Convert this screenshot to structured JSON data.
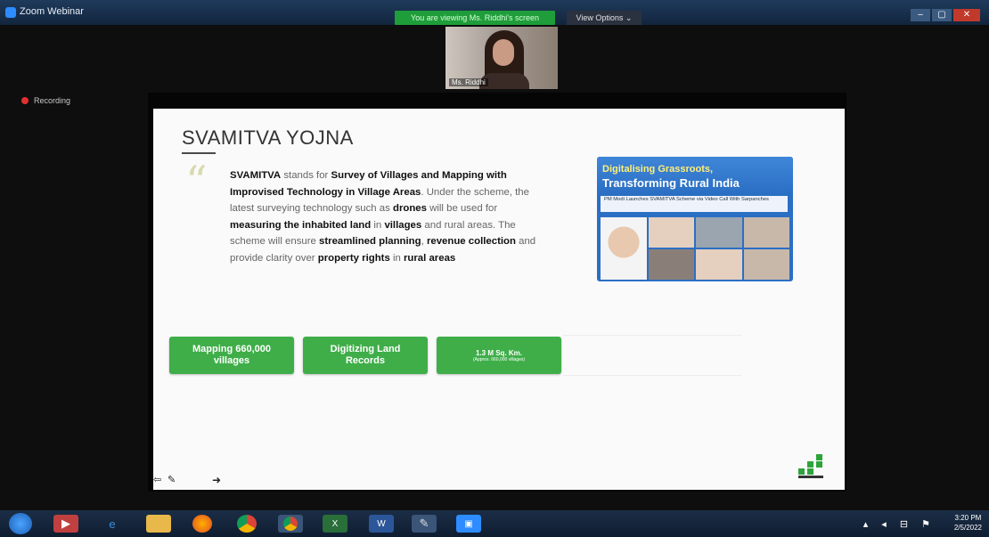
{
  "window": {
    "title": "Zoom Webinar",
    "viewing_banner": "You are viewing Ms. Riddhi's screen",
    "view_options": "View Options ⌄",
    "controls": [
      "–",
      "▢",
      "✕"
    ]
  },
  "meeting": {
    "recording_label": "Recording",
    "participant_name": "Ms. Riddhi"
  },
  "slide": {
    "title": "SVAMITVA YOJNA",
    "quote_mark": "“",
    "body": {
      "p1": "SVAMITVA",
      "p2": " stands for ",
      "p3": "Survey of Villages and Mapping with Improvised Technology in Village Areas",
      "p4": ". Under the scheme, the latest surveying technology such as ",
      "p5": "drones",
      "p6": " will be used for ",
      "p7": "measuring the inhabited land",
      "p8": " in ",
      "p9": "villages",
      "p10": " and rural areas. The scheme will ensure ",
      "p11": "streamlined planning",
      "p12": ", ",
      "p13": "revenue collection",
      "p14": " and provide clarity over ",
      "p15": "property rights",
      "p16": " in ",
      "p17": "rural areas"
    },
    "news_card": {
      "line1": "Digitalising Grassroots,",
      "line2": "Transforming Rural India",
      "caption": "PM Modi Launches SVAMITVA Scheme via Video Call With Sarpanches"
    },
    "buttons": {
      "b1_l1": "Mapping 660,000",
      "b1_l2": "villages",
      "b2_l1": "Digitizing Land",
      "b2_l2": "Records",
      "b3_big": "1.3 M Sq. Km.",
      "b3_small": "(Approx. 660,000 villages)"
    }
  },
  "taskbar": {
    "icons": [
      "start-icon",
      "media-icon",
      "ie-icon",
      "folder-icon",
      "firefox-icon",
      "chrome-icon",
      "chrome2-icon",
      "excel-icon",
      "word-icon",
      "paint-icon",
      "zoom-icon"
    ],
    "tray": "▴ ◂ ⊟ ⚑",
    "time": "3:20 PM",
    "date": "2/5/2022"
  },
  "colors": {
    "accent_green": "#3fae49",
    "title_bar": "#1f3a5c",
    "viewing_banner": "#1e9d3a"
  }
}
